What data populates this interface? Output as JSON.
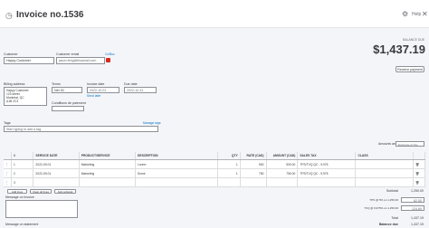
{
  "header": {
    "title": "Invoice no.1536",
    "clock_icon": "clock-icon",
    "settings_icon": "gear-icon",
    "help_label": "Help",
    "close_icon": "close-icon"
  },
  "customer": {
    "label": "Customer",
    "value": "Happy Customer"
  },
  "email": {
    "label": "Customer email",
    "value": "jason.ferig@tesamail.com",
    "cc_bcc": "Cc/Bcc"
  },
  "balance": {
    "label": "BALANCE DUE",
    "amount": "$1,437.19",
    "receive_payment": "Receive payment"
  },
  "billing": {
    "label": "Billing address",
    "lines": [
      "Happy Customer",
      "123 street",
      "Montréal, QC",
      "A1B 2C3"
    ]
  },
  "terms": {
    "label": "Terms",
    "value": "Net 30"
  },
  "invoice_date": {
    "label": "Invoice date",
    "value": "2022-10-01"
  },
  "due_date": {
    "label": "Due date",
    "value": "2022-10-31"
  },
  "send_later": "Send later",
  "conditions": {
    "label": "Conditions de paiement",
    "value": ""
  },
  "tags": {
    "label": "Tags",
    "placeholder": "Start typing to add a tag",
    "manage": "Manage tags"
  },
  "amounts_are": {
    "label": "Amounts are",
    "value": "Exclusive of Tax"
  },
  "table": {
    "columns": [
      "#",
      "SERVICE DATE",
      "PRODUCT/SERVICE",
      "DESCRIPTION",
      "QTY",
      "RATE (CAD)",
      "AMOUNT (CAD)",
      "SALES TAX",
      "CLASS"
    ],
    "rows": [
      {
        "num": "1",
        "date": "2022-09-01",
        "product": "Marketing",
        "desc": "Lorem",
        "qty": "1",
        "rate": "500",
        "amount": "500.00",
        "tax": "TPS/TVQ QC - 9,975"
      },
      {
        "num": "2",
        "date": "2022-09-01",
        "product": "Marketing",
        "desc": "Some",
        "qty": "1",
        "rate": "750",
        "amount": "750.00",
        "tax": "TPS/TVQ QC - 9,975"
      },
      {
        "num": "3",
        "date": "",
        "product": "",
        "desc": "",
        "qty": "",
        "rate": "",
        "amount": "",
        "tax": ""
      }
    ]
  },
  "buttons": {
    "add_lines": "Add lines",
    "clear_all": "Clear all lines",
    "add_subtotal": "Add subtotal"
  },
  "message_invoice": {
    "label": "Message on invoice",
    "placeholder": ""
  },
  "message_statement": {
    "label": "Message on statement"
  },
  "totals": {
    "subtotal_label": "Subtotal",
    "subtotal": "1,250.00",
    "tps_label": "TPS @ 5% on 1,250.00",
    "tps": "62.50",
    "tvq_label": "TVQ @ 9.975% on 1,250.00",
    "tvq": "124.69",
    "total_label": "Total",
    "total": "1,437.19",
    "balance_label": "Balance due",
    "balance": "1,437.19"
  }
}
